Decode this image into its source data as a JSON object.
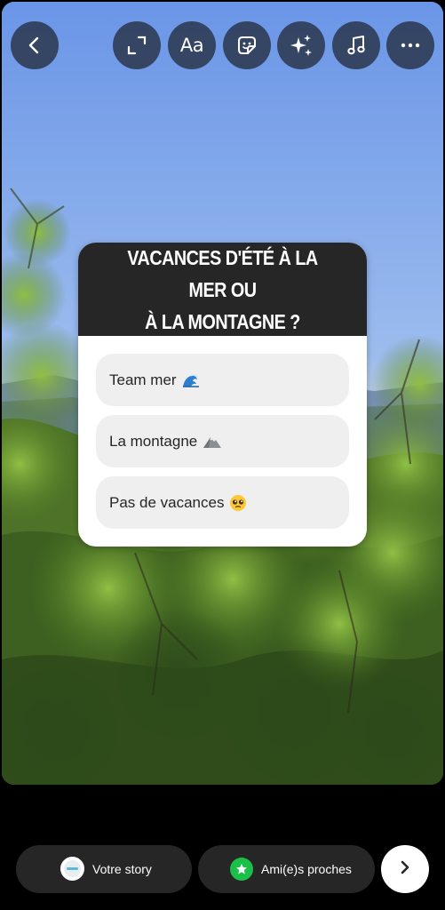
{
  "toolbar": {
    "back_icon": "chevron-left-icon",
    "expand_icon": "expand-icon",
    "text_label": "Aa",
    "sticker_icon": "sticker-icon",
    "effects_icon": "sparkles-icon",
    "music_icon": "music-note-icon",
    "more_icon": "more-horizontal-icon"
  },
  "poll": {
    "question_line1": "VACANCES D'ÉTÉ À LA MER OU",
    "question_line2": "À LA MONTAGNE ?",
    "options": [
      {
        "label": "Team mer",
        "emoji_icon": "wave-icon"
      },
      {
        "label": "La montagne",
        "emoji_icon": "mountain-icon"
      },
      {
        "label": "Pas de vacances",
        "emoji_icon": "pleading-face-icon"
      }
    ]
  },
  "share": {
    "your_story_label": "Votre story",
    "close_friends_label": "Ami(e)s proches",
    "next_icon": "chevron-right-icon"
  },
  "colors": {
    "poll_header_bg": "#262626",
    "option_bg": "#efefef",
    "close_friends_green": "#1bc048",
    "pill_bg": "#262626"
  }
}
